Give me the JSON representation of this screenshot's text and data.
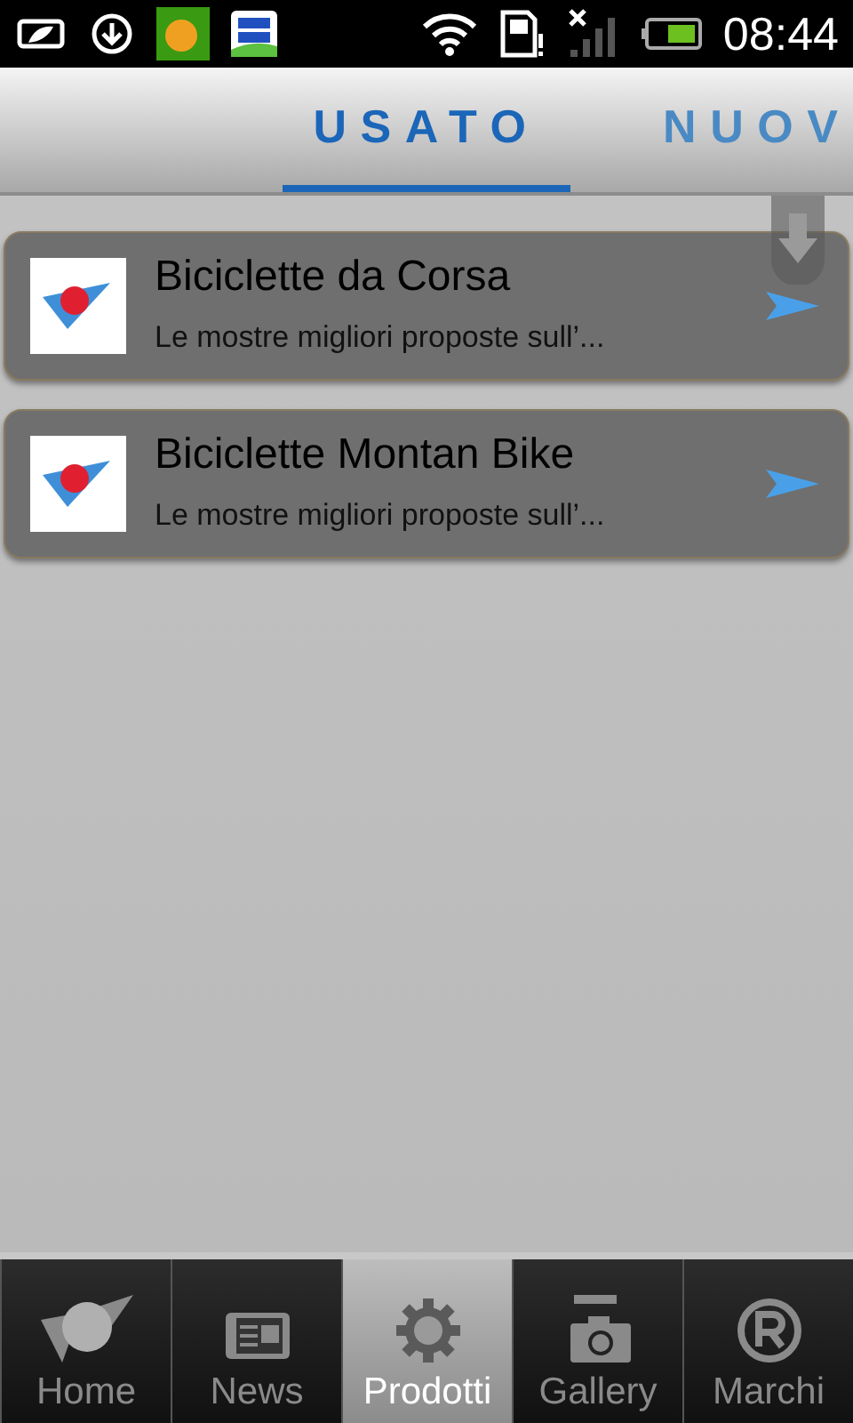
{
  "status_bar": {
    "time": "08:44"
  },
  "tabs": [
    {
      "label": "USATO",
      "selected": true
    },
    {
      "label": "NUOV",
      "selected": false
    }
  ],
  "list": [
    {
      "title": "Biciclette da Corsa",
      "subtitle": "Le mostre migliori proposte sull’..."
    },
    {
      "title": "Biciclette Montan Bike",
      "subtitle": "Le mostre migliori proposte sull’..."
    }
  ],
  "bottom_nav": [
    {
      "label": "Home",
      "kind": "home",
      "selected": false
    },
    {
      "label": "News",
      "kind": "news",
      "selected": false
    },
    {
      "label": "Prodotti",
      "kind": "gear",
      "selected": true
    },
    {
      "label": "Gallery",
      "kind": "camera",
      "selected": false
    },
    {
      "label": "Marchi",
      "kind": "registered",
      "selected": false
    }
  ]
}
